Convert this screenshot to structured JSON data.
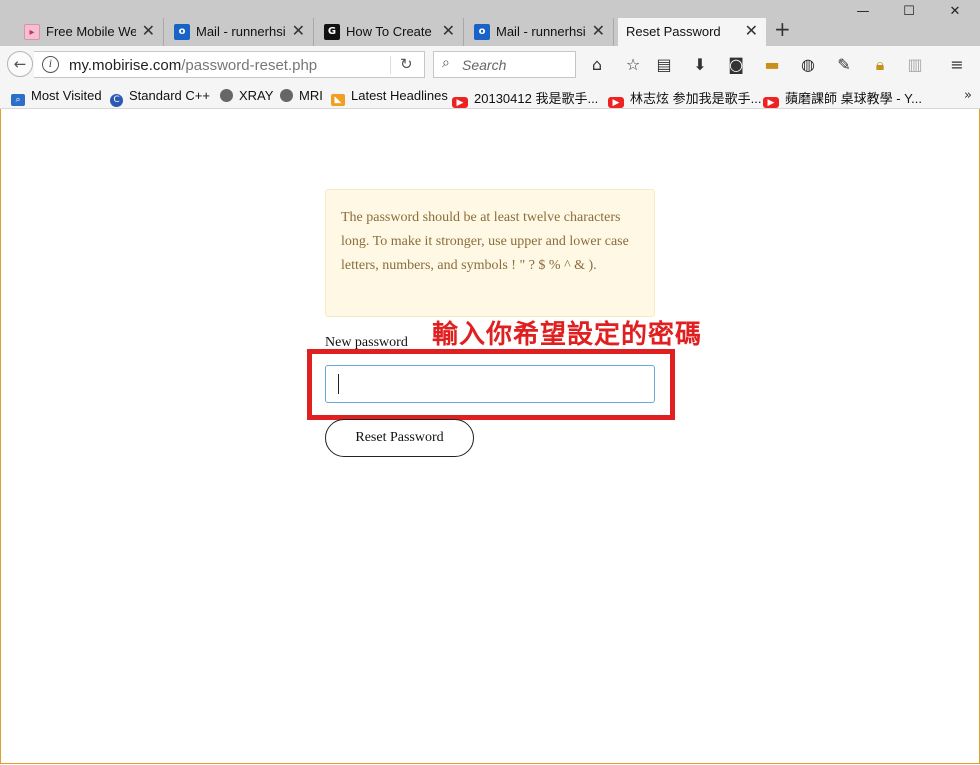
{
  "tabs": [
    {
      "title": "Free Mobile Website Builder",
      "icon": "mobirise-icon",
      "active": false
    },
    {
      "title": "Mail - runnerhsieh",
      "icon": "outlook-icon",
      "active": false
    },
    {
      "title": "How To Create Password",
      "icon": "g-icon",
      "active": false
    },
    {
      "title": "Mail - runnerhsieh",
      "icon": "outlook-icon",
      "active": false
    },
    {
      "title": "Reset Password",
      "icon": "",
      "active": true
    }
  ],
  "window_controls": {
    "minimize": "—",
    "maximize": "☐",
    "close": "✕"
  },
  "navbar": {
    "url_host": "my.mobirise.com",
    "url_path": "/password-reset.php",
    "search_placeholder": "Search"
  },
  "bookmarks": [
    {
      "label": "Most Visited",
      "icon": "most-visited-icon"
    },
    {
      "label": "Standard C++",
      "icon": "cpp-icon"
    },
    {
      "label": "XRAY",
      "icon": "globe-icon"
    },
    {
      "label": "MRI",
      "icon": "globe-icon"
    },
    {
      "label": "Latest Headlines",
      "icon": "rss-icon"
    },
    {
      "label": "20130412 我是歌手...",
      "icon": "youtube-icon"
    },
    {
      "label": "林志炫 参加我是歌手...",
      "icon": "youtube-icon"
    },
    {
      "label": "蘋磨課師 桌球教學 - Y...",
      "icon": "youtube-icon"
    }
  ],
  "page": {
    "notice": "The password should be at least twelve characters long. To make it stronger, use upper and lower case letters, numbers, and symbols ! \" ? $ % ^ & ).",
    "new_password_label": "New password",
    "reset_button": "Reset Password",
    "annotation": "輸入你希望設定的密碼"
  },
  "colors": {
    "annotation": "#e02020",
    "notice_bg": "#fef8e4",
    "notice_text": "#8a6d3b"
  }
}
